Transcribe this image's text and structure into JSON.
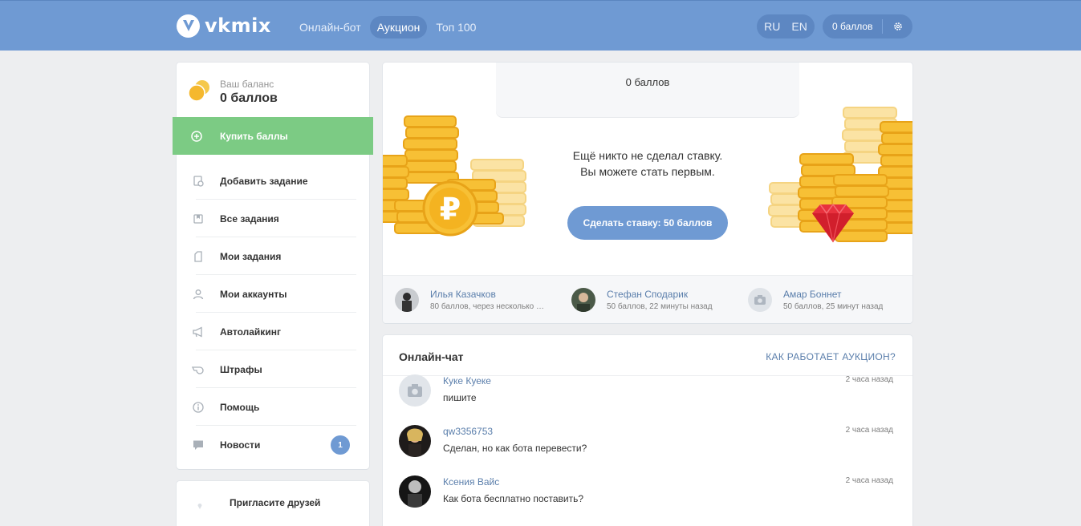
{
  "header": {
    "logo_text": "vkmix",
    "nav": [
      "Онлайн-бот",
      "Аукцион",
      "Топ 100"
    ],
    "langs": [
      "RU",
      "EN"
    ],
    "balance": "0 баллов"
  },
  "sidebar": {
    "balance_label": "Ваш баланс",
    "balance_value": "0 баллов",
    "buy_label": "Купить баллы",
    "items": [
      {
        "label": "Добавить задание",
        "icon": "add-task-icon"
      },
      {
        "label": "Все задания",
        "icon": "tasks-icon"
      },
      {
        "label": "Мои задания",
        "icon": "my-tasks-icon"
      },
      {
        "label": "Мои аккаунты",
        "icon": "user-icon"
      },
      {
        "label": "Автолайкинг",
        "icon": "megaphone-icon"
      },
      {
        "label": "Штрафы",
        "icon": "whistle-icon"
      },
      {
        "label": "Помощь",
        "icon": "info-icon"
      },
      {
        "label": "Новости",
        "icon": "chat-icon",
        "badge": "1"
      }
    ],
    "invite_label": "Пригласите друзей"
  },
  "auction": {
    "pot": "0 баллов",
    "message_line1": "Ещё никто не сделал ставку.",
    "message_line2": "Вы можете стать первым.",
    "bid_button": "Сделать ставку: 50 баллов",
    "bidders": [
      {
        "name": "Илья Казачков",
        "detail": "80 баллов, через несколько с..."
      },
      {
        "name": "Стефан Сподарик",
        "detail": "50 баллов, 22 минуты назад"
      },
      {
        "name": "Амар Боннет",
        "detail": "50 баллов, 25 минут назад"
      }
    ]
  },
  "chat": {
    "title": "Онлайн-чат",
    "how_link": "КАК РАБОТАЕТ АУКЦИОН?",
    "messages": [
      {
        "name": "Куке Куеке",
        "text": "пишите",
        "time": "2 часа назад"
      },
      {
        "name": "qw3356753",
        "text": "Сделан, но как бота перевести?",
        "time": "2 часа назад"
      },
      {
        "name": "Ксения Вайс",
        "text": "Как бота бесплатно поставить?",
        "time": "2 часа назад"
      }
    ]
  },
  "colors": {
    "header": "#6f9ad3",
    "accent_green": "#7ccb84",
    "link": "#5a7eab",
    "coin": "#f5b82e"
  }
}
